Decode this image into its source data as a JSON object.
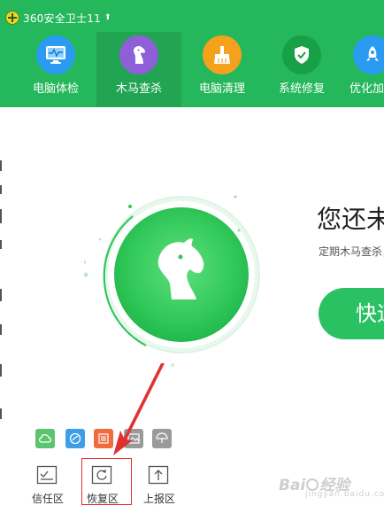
{
  "window": {
    "title": "360安全卫士11",
    "title_arrow": "⬆"
  },
  "nav": {
    "items": [
      {
        "label": "电脑体检",
        "icon": "monitor-icon",
        "color": "#2a9bf0",
        "active": false
      },
      {
        "label": "木马查杀",
        "icon": "horse-icon",
        "color": "#8e5fd9",
        "active": true
      },
      {
        "label": "电脑清理",
        "icon": "broom-icon",
        "color": "#f6a11b",
        "active": false
      },
      {
        "label": "系统修复",
        "icon": "shield-icon",
        "color": "#18a046",
        "active": false
      },
      {
        "label": "优化加速",
        "icon": "rocket-icon",
        "color": "#2a9bf0",
        "active": false
      }
    ]
  },
  "main": {
    "headline": "您还未进行木马查杀",
    "subtext": "定期木马查杀，保护电脑安全",
    "quick_button": "快速查杀",
    "center_icon": "horse-icon"
  },
  "mini_tools": [
    {
      "icon": "cloud-icon",
      "color": "#5ac46e"
    },
    {
      "icon": "speed-icon",
      "color": "#3d9ee8"
    },
    {
      "icon": "list-icon",
      "color": "#f26b3f"
    },
    {
      "icon": "image-icon",
      "color": "#9a9a9a"
    },
    {
      "icon": "umbrella-icon",
      "color": "#9a9a9a"
    }
  ],
  "bottom_tools": [
    {
      "label": "信任区",
      "icon": "trust-list-icon"
    },
    {
      "label": "恢复区",
      "icon": "restore-icon"
    },
    {
      "label": "上报区",
      "icon": "upload-icon"
    }
  ],
  "watermark": {
    "text_left": "Bai",
    "text_right": "经验",
    "sub": "jingyan.baidu.com"
  },
  "colors": {
    "header": "#25b75b",
    "active_tab": "#22a553",
    "accent": "#29c161",
    "annotation": "#e23030"
  }
}
